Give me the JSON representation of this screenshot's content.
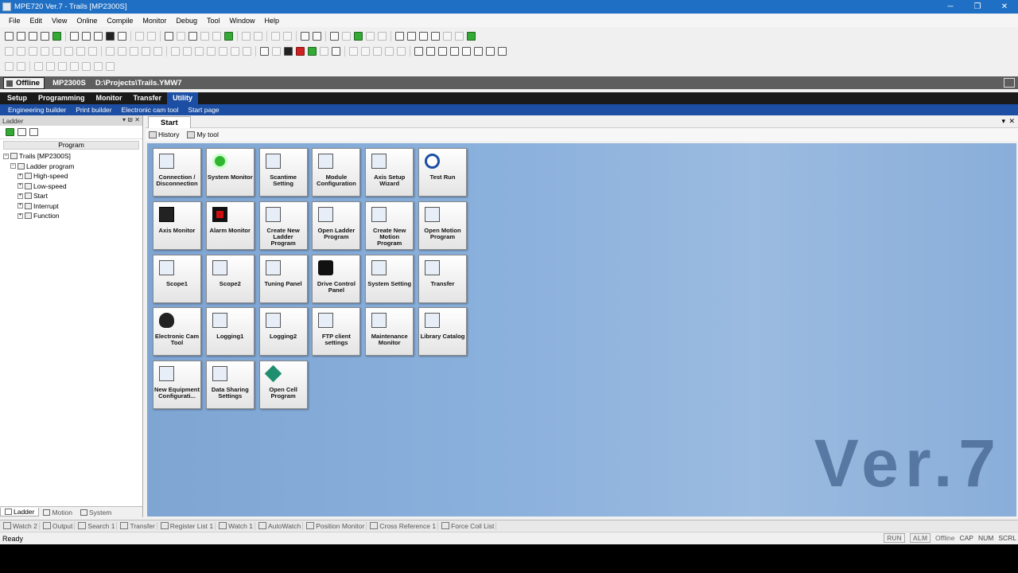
{
  "window": {
    "title": "MPE720 Ver.7 - Trails [MP2300S]",
    "controls": [
      "─",
      "❐",
      "✕"
    ]
  },
  "menu": [
    "File",
    "Edit",
    "View",
    "Online",
    "Compile",
    "Monitor",
    "Debug",
    "Tool",
    "Window",
    "Help"
  ],
  "status_strip": {
    "mode": "Offline",
    "cpu": "MP2300S",
    "path": "D:\\Projects\\Trails.YMW7"
  },
  "ribbon": {
    "tabs": [
      "Setup",
      "Programming",
      "Monitor",
      "Transfer",
      "Utility"
    ],
    "active_tab": "Utility",
    "sub_items": [
      "Engineering builder",
      "Print builder",
      "Electronic cam tool",
      "Start page"
    ]
  },
  "left_pane": {
    "title": "Ladder",
    "controls": "▾ ₪ ✕",
    "column_header": "Program",
    "tree": [
      "Trails [MP2300S]",
      "Ladder program",
      "High-speed",
      "Low-speed",
      "Start",
      "Interrupt",
      "Function"
    ],
    "tabs": [
      "Ladder",
      "Motion",
      "System"
    ]
  },
  "main": {
    "tab": "Start",
    "subtools": [
      "History",
      "My tool"
    ],
    "tiles": [
      "Connection / Disconnection",
      "System Monitor",
      "Scantime Setting",
      "Module Configuration",
      "Axis Setup Wizard",
      "Test Run",
      "Axis Monitor",
      "Alarm Monitor",
      "Create New Ladder Program",
      "Open Ladder Program",
      "Create New Motion Program",
      "Open Motion Program",
      "Scope1",
      "Scope2",
      "Tuning Panel",
      "Drive Control Panel",
      "System Setting",
      "Transfer",
      "Electronic Cam Tool",
      "Logging1",
      "Logging2",
      "FTP client settings",
      "Maintenance Monitor",
      "Library Catalog",
      "New Equipment Configurati...",
      "Data Sharing Settings",
      "Open Cell Program"
    ],
    "tile_icons": [
      "connection-icon",
      "system-monitor-icon",
      "scantime-icon",
      "module-config-icon",
      "axis-setup-icon",
      "test-run-icon",
      "axis-monitor-icon",
      "alarm-monitor-icon",
      "new-ladder-icon",
      "open-ladder-icon",
      "new-motion-icon",
      "open-motion-icon",
      "scope1-icon",
      "scope2-icon",
      "tuning-panel-icon",
      "drive-control-icon",
      "system-setting-icon",
      "transfer-icon",
      "electronic-cam-icon",
      "logging1-icon",
      "logging2-icon",
      "ftp-icon",
      "maintenance-icon",
      "library-icon",
      "new-equipment-icon",
      "data-sharing-icon",
      "open-cell-icon"
    ],
    "watermark": "Ver.7"
  },
  "bottom_tabs": [
    "Watch 2",
    "Output",
    "Search 1",
    "Transfer",
    "Register List 1",
    "Watch 1",
    "AutoWatch",
    "Position Monitor",
    "Cross Reference 1",
    "Force Coil List"
  ],
  "statusbar": {
    "text": "Ready",
    "indicators": [
      "RUN",
      "ALM"
    ],
    "mode": "Offline",
    "keys": [
      "CAP",
      "NUM",
      "SCRL"
    ]
  },
  "colors": {
    "title_bar": "#1f6fc4",
    "ribbon_active": "#1c4ea3",
    "canvas": "#8ab0dc",
    "alarm_red": "#d01010",
    "monitor_green": "#2fb52f"
  }
}
